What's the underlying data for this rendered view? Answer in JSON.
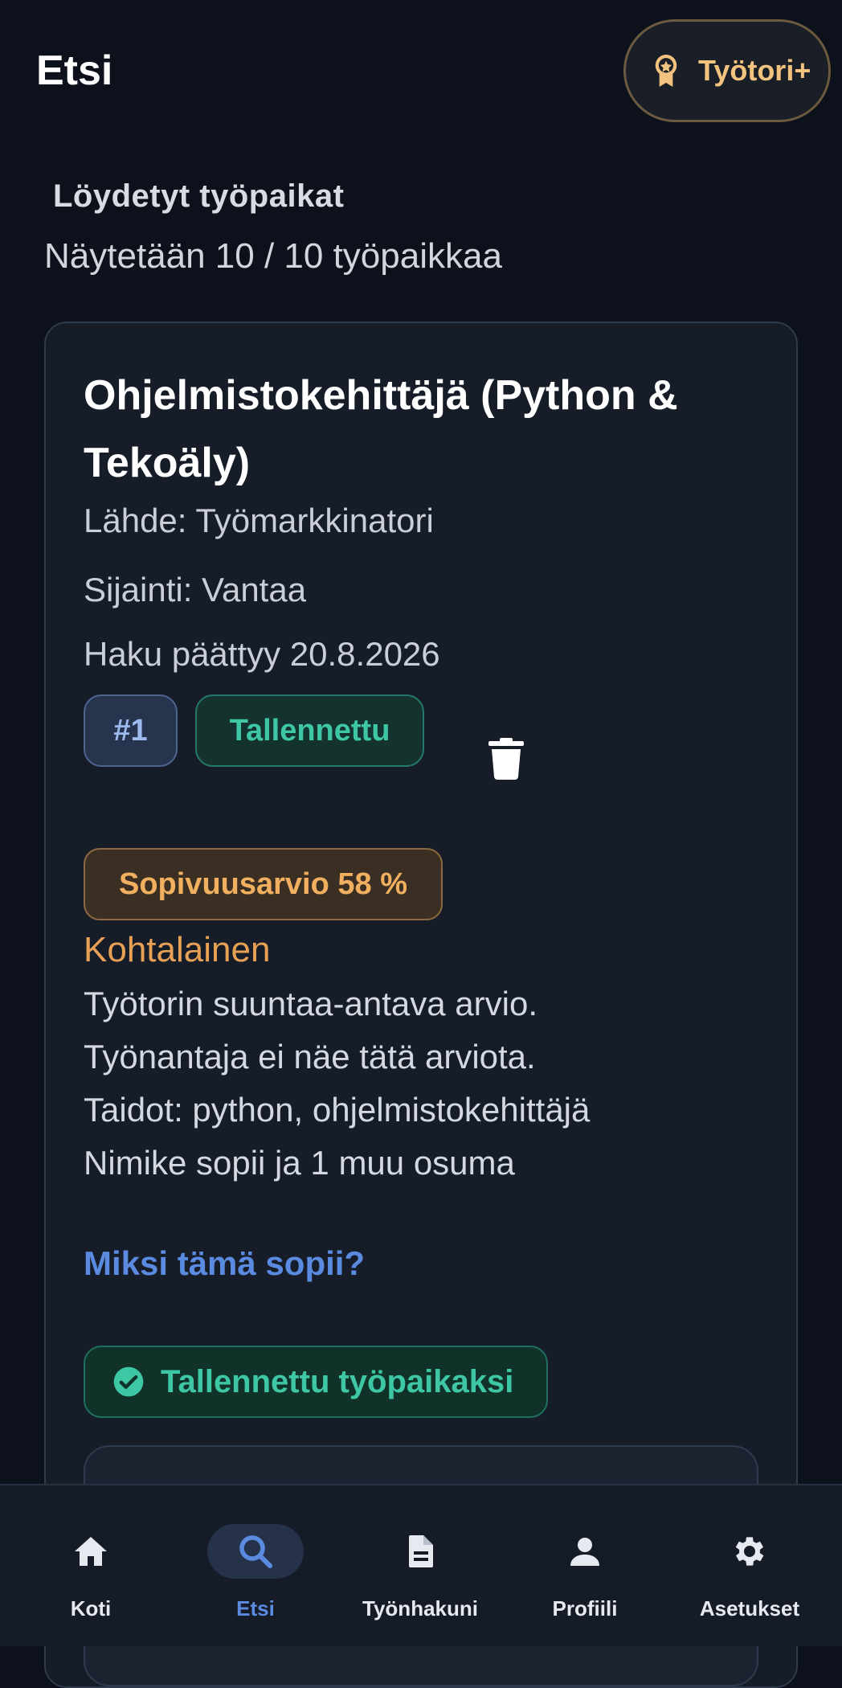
{
  "header": {
    "title": "Etsi",
    "premium_label": "Työtori+"
  },
  "results": {
    "section_label": "Löydetyt työpaikat",
    "count_text": "Näytetään 10 / 10 työpaikkaa"
  },
  "job": {
    "title": "Ohjelmistokehittäjä (Python & Tekoäly)",
    "source": "Lähde: Työmarkkinatori",
    "location": "Sijainti: Vantaa",
    "deadline": "Haku päättyy 20.8.2026",
    "rank_badge": "#1",
    "saved_badge": "Tallennettu",
    "score_badge": "Sopivuusarvio 58 %",
    "score_level": "Kohtalainen",
    "score_lines": [
      "Työtorin suuntaa-antava arvio.",
      "Työnantaja ei näe tätä arviota.",
      "Taidot: python, ohjelmistokehittäjä",
      "Nimike sopii ja 1 muu osuma"
    ],
    "why_link": "Miksi tämä sopii?",
    "saved_banner": "Tallennettu työpaikaksi"
  },
  "nav": {
    "items": [
      {
        "label": "Koti",
        "icon": "home-icon"
      },
      {
        "label": "Etsi",
        "icon": "search-icon",
        "active": true
      },
      {
        "label": "Työnhakuni",
        "icon": "document-icon"
      },
      {
        "label": "Profiili",
        "icon": "person-icon"
      },
      {
        "label": "Asetukset",
        "icon": "gear-icon"
      }
    ]
  },
  "colors": {
    "background": "#0c111b",
    "accent_blue": "#5a8be0",
    "accent_green": "#3ec7a5",
    "accent_orange": "#e8a055",
    "premium_gold": "#f2c37e"
  }
}
